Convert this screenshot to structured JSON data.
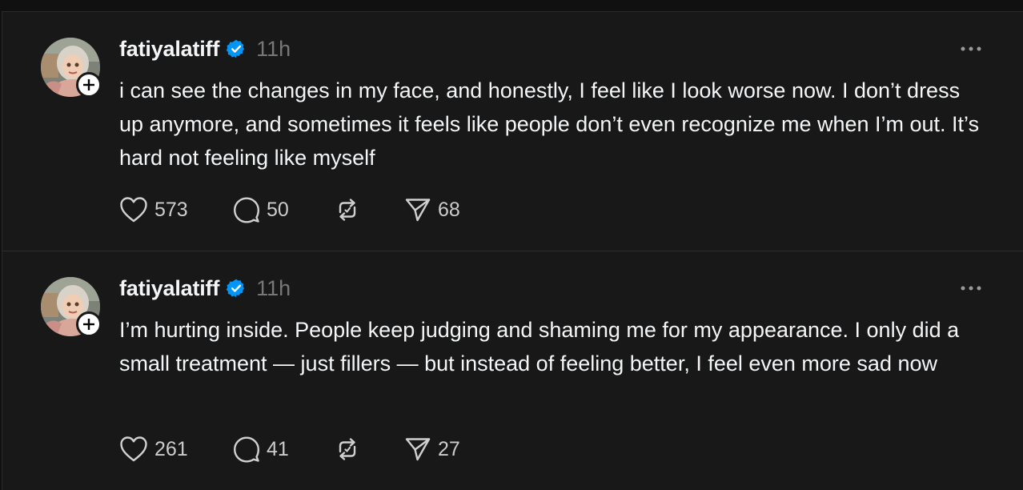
{
  "posts": [
    {
      "username": "fatiyalatiff",
      "time": "11h",
      "text": "i can see the changes in my face, and honestly, I feel like I look worse now. I don’t dress up anymore, and sometimes it feels like people don’t even recognize me when I’m out. It’s hard not feeling like myself",
      "likes": "573",
      "replies": "50",
      "shares": "68"
    },
    {
      "username": "fatiyalatiff",
      "time": "11h",
      "text": "I’m hurting inside. People keep judging and shaming me for my appearance. I only did a small treatment — just fillers — but instead of feeling better, I feel even more sad now",
      "likes": "261",
      "replies": "41",
      "shares": "27"
    }
  ],
  "icons": {
    "verified": "verified-badge-icon",
    "follow": "plus-icon",
    "more": "more-horizontal-icon",
    "like": "heart-icon",
    "reply": "comment-icon",
    "repost": "repost-icon",
    "share": "send-icon"
  },
  "colors": {
    "background": "#181818",
    "text": "#f3f5f7",
    "muted": "#777777",
    "verified": "#0095f6"
  }
}
